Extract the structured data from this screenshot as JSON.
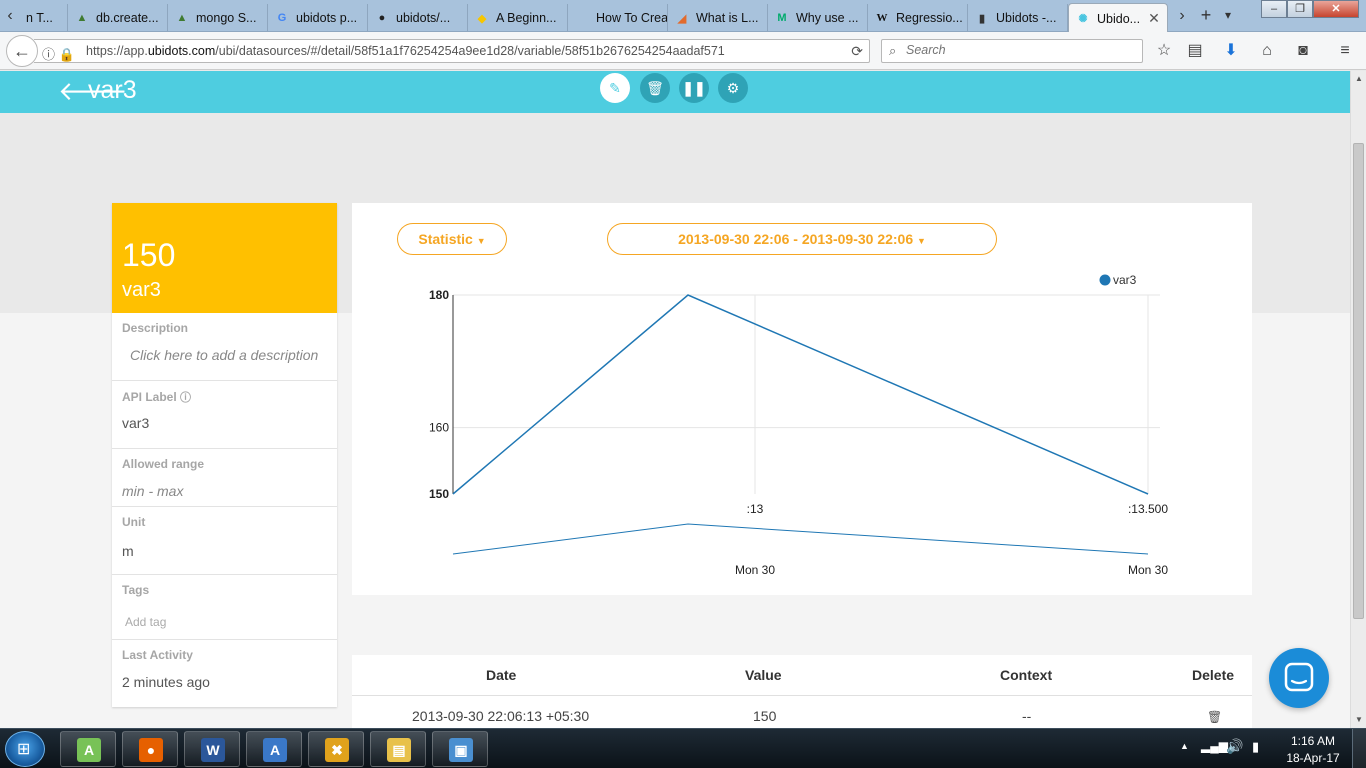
{
  "browser": {
    "tabs": [
      {
        "title": "n T...",
        "icon": "page-icon",
        "color": "#888888",
        "glyph": ""
      },
      {
        "title": "db.create...",
        "icon": "mongodb-leaf-icon",
        "color": "#3f7b31",
        "glyph": "▲"
      },
      {
        "title": "mongo S...",
        "icon": "mongodb-leaf-icon",
        "color": "#3f7b31",
        "glyph": "▲"
      },
      {
        "title": "ubidots p...",
        "icon": "google-icon",
        "color": "#4285f4",
        "glyph": "G"
      },
      {
        "title": "ubidots/...",
        "icon": "github-icon",
        "color": "#222222",
        "glyph": "●"
      },
      {
        "title": "A Beginn...",
        "icon": "lightbulb-icon",
        "color": "#f7c600",
        "glyph": "◆"
      },
      {
        "title": "How To Creat...",
        "icon": "page-icon",
        "color": "#cfcfcf",
        "glyph": ""
      },
      {
        "title": "What is L...",
        "icon": "orange-logo-icon",
        "color": "#e26a2c",
        "glyph": "◢"
      },
      {
        "title": "Why use ...",
        "icon": "medium-icon",
        "color": "#00ab6c",
        "glyph": "M"
      },
      {
        "title": "Regressio...",
        "icon": "wikipedia-icon",
        "color": "#ffffff",
        "glyph": "W"
      },
      {
        "title": "Ubidots -...",
        "icon": "book-icon",
        "color": "#333333",
        "glyph": "▮"
      },
      {
        "title": "Ubido...",
        "icon": "ubidots-icon",
        "color": "#49c5e0",
        "glyph": "✺",
        "active": true
      }
    ],
    "url_prefix": "https://app.",
    "url_domain": "ubidots.com",
    "url_rest": "/ubi/datasources/#/detail/58f51a1f76254254a9ee1d28/variable/58f51b2676254254aadaf571",
    "search_placeholder": "Search"
  },
  "header": {
    "title": "var3",
    "actions": [
      "edit",
      "delete",
      "pause",
      "settings"
    ]
  },
  "variable": {
    "last_value": "150",
    "name": "var3",
    "description_label": "Description",
    "description_placeholder": "Click here to add a description",
    "api_label_label": "API Label",
    "api_label": "var3",
    "range_label": "Allowed range",
    "range_placeholder": "min - max",
    "unit_label": "Unit",
    "unit": "m",
    "tags_label": "Tags",
    "tags_placeholder": "Add tag",
    "last_activity_label": "Last Activity",
    "last_activity": "2 minutes ago"
  },
  "controls": {
    "statistic_label": "Statistic",
    "date_range_label": "2013-09-30 22:06 - 2013-09-30 22:06"
  },
  "chart_data": {
    "type": "line",
    "series": [
      {
        "name": "var3",
        "values": [
          150,
          180,
          150
        ],
        "color": "#1f77b4"
      }
    ],
    "x_ticks_top": [
      "",
      ":13",
      ":13.500"
    ],
    "x_ticks_bottom": [
      "",
      "Mon 30",
      "Mon 30"
    ],
    "y_ticks": [
      150,
      160,
      180
    ],
    "ylim": [
      150,
      180
    ],
    "legend": "top-right",
    "grid": true,
    "navigator_values": [
      150,
      180,
      150
    ]
  },
  "table": {
    "headers": [
      "Date",
      "Value",
      "Context",
      "Delete"
    ],
    "rows": [
      {
        "date": "2013-09-30 22:06:13 +05:30",
        "value": "150",
        "context": "--"
      }
    ]
  },
  "taskbar": {
    "apps": [
      {
        "name": "android-studio-icon",
        "color": "#78c257",
        "glyph": "A"
      },
      {
        "name": "firefox-icon",
        "color": "#e66000",
        "glyph": "●"
      },
      {
        "name": "word-icon",
        "color": "#2b579a",
        "glyph": "W"
      },
      {
        "name": "paint-icon",
        "color": "#3a78c8",
        "glyph": "A"
      },
      {
        "name": "matlab-icon",
        "color": "#e0a21c",
        "glyph": "✖"
      },
      {
        "name": "file-explorer-icon",
        "color": "#e8c14a",
        "glyph": "▤"
      },
      {
        "name": "photo-viewer-icon",
        "color": "#4a8fd0",
        "glyph": "▣"
      }
    ],
    "time": "1:16 AM",
    "date": "18-Apr-17"
  }
}
